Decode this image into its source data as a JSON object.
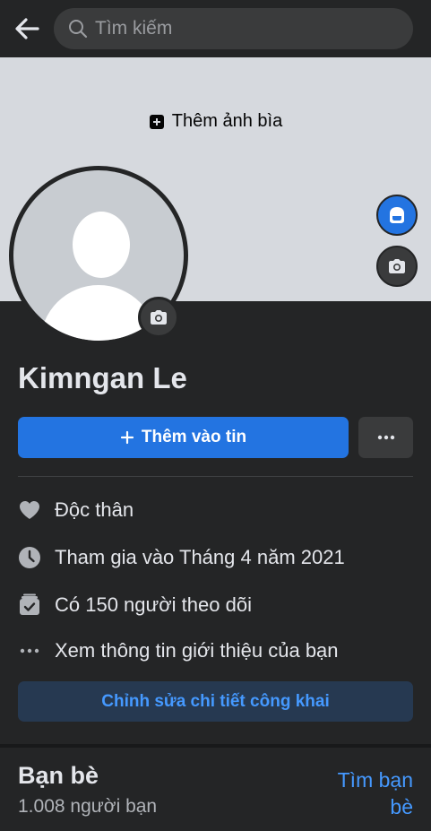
{
  "search": {
    "placeholder": "Tìm kiếm"
  },
  "cover": {
    "add_cover_label": "Thêm ảnh bìa"
  },
  "profile": {
    "name": "Kimngan Le"
  },
  "actions": {
    "add_story_label": "Thêm vào tin",
    "more_label": "···"
  },
  "info": [
    {
      "icon": "heart-icon",
      "text": "Độc thân"
    },
    {
      "icon": "clock-icon",
      "text": "Tham gia vào Tháng 4 năm 2021"
    },
    {
      "icon": "followers-icon",
      "text": "Có 150 người theo dõi"
    },
    {
      "icon": "ellipsis-icon",
      "text": "Xem thông tin giới thiệu của bạn"
    }
  ],
  "edit": {
    "label": "Chỉnh sửa chi tiết công khai"
  },
  "friends": {
    "title": "Bạn bè",
    "count": "1.008 người bạn",
    "find_label": "Tìm bạn bè"
  },
  "colors": {
    "accent": "#2374e1",
    "link": "#4599ff",
    "background": "#242526"
  }
}
